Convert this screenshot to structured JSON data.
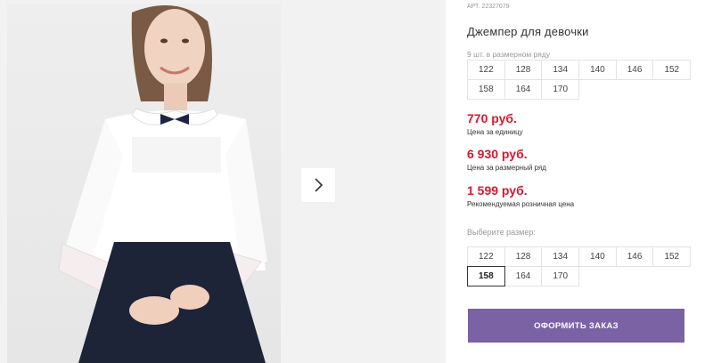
{
  "product": {
    "art_label": "АРТ.",
    "art_number": "22327079",
    "title": "Джемпер для девочки",
    "pack_note": "9 шт. в размерном ряду",
    "pack_sizes": [
      "122",
      "128",
      "134",
      "140",
      "146",
      "152",
      "158",
      "164",
      "170"
    ],
    "prices": {
      "unit_price": "770 руб.",
      "unit_label": "Цена за единицу",
      "row_price": "6 930 руб.",
      "row_label": "Цена за размерный ряд",
      "rrp_price": "1 599 руб.",
      "rrp_label": "Рекомендуемая розничная цена"
    },
    "choose_label": "Выберите размер:",
    "select_sizes": [
      "122",
      "128",
      "134",
      "140",
      "146",
      "152",
      "158",
      "164",
      "170"
    ],
    "selected_size": "158",
    "order_button": "ОФОРМИТЬ ЗАКАЗ"
  },
  "gallery": {
    "next_icon": "chevron-right-icon"
  },
  "colors": {
    "accent_price": "#d71830",
    "order_button_bg": "#7a62a4"
  }
}
